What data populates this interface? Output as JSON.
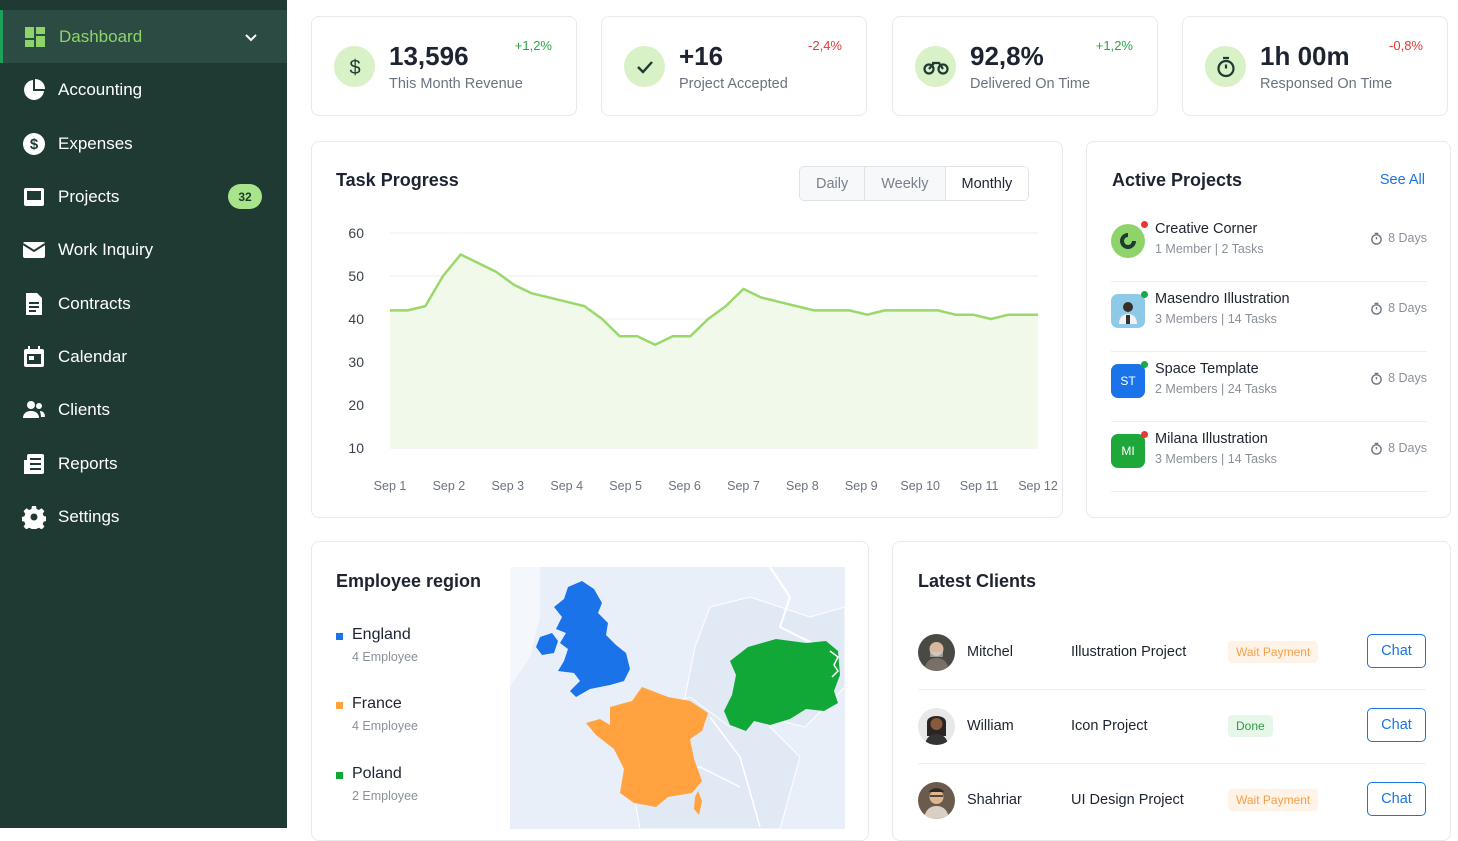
{
  "sidebar": {
    "items": [
      {
        "label": "Dashboard",
        "icon": "dashboard-icon"
      },
      {
        "label": "Accounting",
        "icon": "pie-chart-icon"
      },
      {
        "label": "Expenses",
        "icon": "dollar-icon"
      },
      {
        "label": "Projects",
        "icon": "inbox-icon",
        "badge": "32"
      },
      {
        "label": "Work Inquiry",
        "icon": "mail-icon"
      },
      {
        "label": "Contracts",
        "icon": "document-icon"
      },
      {
        "label": "Calendar",
        "icon": "calendar-icon"
      },
      {
        "label": "Clients",
        "icon": "users-icon"
      },
      {
        "label": "Reports",
        "icon": "report-icon"
      },
      {
        "label": "Settings",
        "icon": "gear-icon"
      }
    ]
  },
  "stats": [
    {
      "value": "13,596",
      "label": "This Month Revenue",
      "change": "+1,2%",
      "icon": "dollar-icon"
    },
    {
      "value": "+16",
      "label": "Project Accepted",
      "change": "-2,4%",
      "icon": "check-icon"
    },
    {
      "value": "92,8%",
      "label": "Delivered On Time",
      "change": "+1,2%",
      "icon": "motorbike-icon"
    },
    {
      "value": "1h 00m",
      "label": "Responsed On Time",
      "change": "-0,8%",
      "icon": "timer-icon"
    }
  ],
  "task_progress": {
    "title": "Task Progress",
    "tabs": [
      "Daily",
      "Weekly",
      "Monthly"
    ],
    "active_tab": "Monthly"
  },
  "chart_data": {
    "type": "area",
    "title": "Task Progress",
    "x_categories": [
      "Sep 1",
      "Sep 2",
      "Sep 3",
      "Sep 4",
      "Sep 5",
      "Sep 6",
      "Sep 7",
      "Sep 8",
      "Sep 9",
      "Sep 10",
      "Sep 11",
      "Sep 12"
    ],
    "yticks": [
      60,
      50,
      40,
      30,
      20,
      10
    ],
    "ylim": [
      10,
      60
    ],
    "grid": true,
    "line_color": "#9ad86a",
    "fill_color": "#f1f9ea",
    "series": [
      {
        "x": [
          1,
          1.3,
          1.6,
          1.9,
          2.2,
          2.5,
          2.8,
          3.1,
          3.4,
          3.7,
          4.0,
          4.3,
          4.6,
          4.9,
          5.2,
          5.5,
          5.8,
          6.1,
          6.4,
          6.7,
          7.0,
          7.3,
          7.6,
          7.9,
          8.2,
          8.5,
          8.8,
          9.1,
          9.4,
          9.7,
          10.0,
          10.3,
          10.6,
          10.9,
          11.2,
          11.5,
          11.8,
          12.0
        ],
        "y": [
          42,
          42,
          43,
          50,
          55,
          53,
          51,
          48,
          46,
          45,
          44,
          43,
          40,
          36,
          36,
          34,
          36,
          36,
          40,
          43,
          47,
          45,
          44,
          43,
          42,
          42,
          42,
          41,
          42,
          42,
          42,
          42,
          41,
          41,
          40,
          41,
          41,
          41
        ]
      }
    ]
  },
  "active_projects": {
    "title": "Active Projects",
    "see_all": "See All",
    "items": [
      {
        "name": "Creative Corner",
        "meta": "1 Member | 2 Tasks",
        "days": "8 Days",
        "initials": "",
        "color": "#8fd46a",
        "status": "#e53935"
      },
      {
        "name": "Masendro Illustration",
        "meta": "3 Members | 14 Tasks",
        "days": "8 Days",
        "initials": "",
        "color": "#8fc9e8",
        "status": "#1aa84a"
      },
      {
        "name": "Space Template",
        "meta": "2 Members | 24 Tasks",
        "days": "8 Days",
        "initials": "ST",
        "color": "#1a73e8",
        "status": "#1aa84a"
      },
      {
        "name": "Milana Illustration",
        "meta": "3 Members | 14 Tasks",
        "days": "8 Days",
        "initials": "MI",
        "color": "#1fa83a",
        "status": "#e53935"
      }
    ]
  },
  "employee_region": {
    "title": "Employee region",
    "regions": [
      {
        "name": "England",
        "count": "4 Employee",
        "color": "#1a73e8"
      },
      {
        "name": "France",
        "count": "4 Employee",
        "color": "#ffa23f"
      },
      {
        "name": "Poland",
        "count": "2 Employee",
        "color": "#12a838"
      }
    ]
  },
  "latest_clients": {
    "title": "Latest Clients",
    "items": [
      {
        "name": "Mitchel",
        "project": "Illustration Project",
        "status": "Wait Payment",
        "status_type": "wait",
        "action": "Chat"
      },
      {
        "name": "William",
        "project": "Icon Project",
        "status": "Done",
        "status_type": "done",
        "action": "Chat"
      },
      {
        "name": "Shahriar",
        "project": "UI Design Project",
        "status": "Wait Payment",
        "status_type": "wait",
        "action": "Chat"
      }
    ]
  }
}
